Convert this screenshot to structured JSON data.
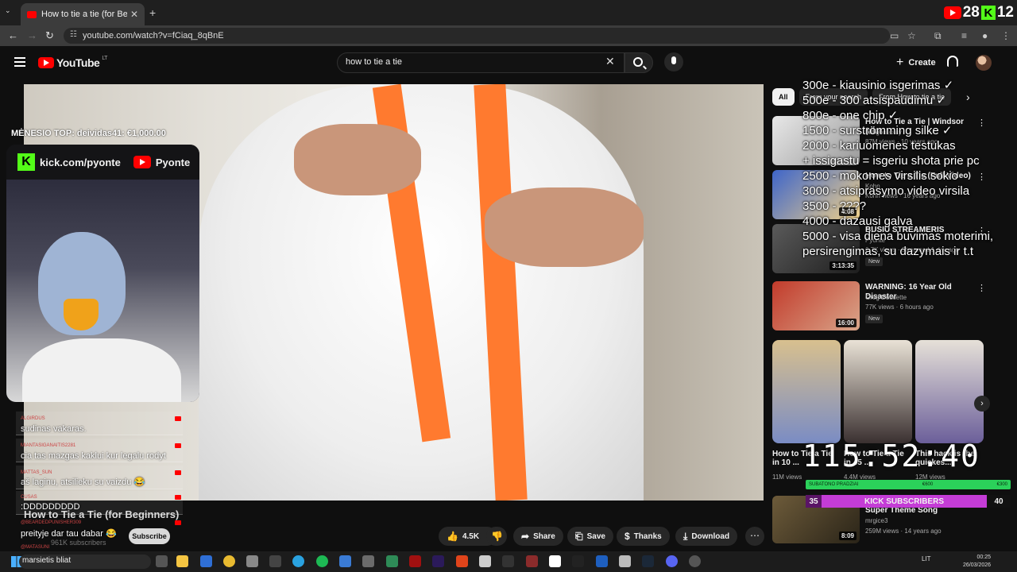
{
  "browser": {
    "tab_title": "How to tie a tie (for Beginners)",
    "url": "youtube.com/watch?v=fCiaq_8qBnE"
  },
  "overlay_top": {
    "yt_count": "28",
    "kick_count": "12"
  },
  "youtube": {
    "logo_text": "YouTube",
    "logo_region": "LT",
    "search_value": "how to tie a tie",
    "create_label": "Create"
  },
  "stream": {
    "top_donor": "MĖNESIO TOP: deividas41: €1,000.00",
    "kick_handle": "kick.com/pyonte",
    "yt_handle": "Pyonte"
  },
  "chat": [
    {
      "name": "ALGIRDUS",
      "text": "sudinas vakaras."
    },
    {
      "name": "MIANTASIGANAITIS2281",
      "text": "cia tas mazgas kaklui kur legalu rodyt"
    },
    {
      "name": "MATTAS_SUN",
      "text": "aš laginu, atsilieku su vaizdu 😂"
    },
    {
      "name": "CUSAS",
      "text": ":DDDDDDDDD"
    },
    {
      "name": "@BEARDEDPUNISHER309",
      "text": "preityje dar tau dabar 😂"
    },
    {
      "name": "@MATASUNI",
      "text": "marsietis bliat"
    }
  ],
  "video": {
    "title": "How to Tie a Tie (for Beginners)",
    "subscribers": "961K subscribers",
    "subscribe_label": "Subscribe"
  },
  "actions": {
    "likes": "4.5K",
    "share": "Share",
    "save": "Save",
    "thanks": "Thanks",
    "download": "Download"
  },
  "chips": [
    "All",
    "From your search",
    "From How to tie a tie"
  ],
  "recommendations": [
    {
      "title": "How to Tie a Tie | Windsor (aka",
      "channel": "dangonebiay",
      "meta": "87M views · 10 years ago",
      "duration": "",
      "new": ""
    },
    {
      "title": "How to Tie a Tie (Full Video)",
      "channel": "Kohn",
      "meta": "Kohn views · 16 years ago",
      "duration": "4:08",
      "new": ""
    },
    {
      "title": "BUSIU STREAMERIS",
      "channel": "Pyonte",
      "meta": "6.7K views · Streamed 1 day ago",
      "duration": "3:13:35",
      "new": "New"
    },
    {
      "title": "WARNING: 16 Year Old Disaster",
      "channel": "Greg Doucette",
      "meta": "77K views · 6 hours ago",
      "duration": "16:00",
      "new": "New"
    }
  ],
  "shorts": [
    {
      "title": "How to Tie a Tie in 10 ...",
      "views": "11M views"
    },
    {
      "title": "How to Tie a Tie in 45 ...",
      "views": "4.4M views"
    },
    {
      "title": "This hack is the quickes...",
      "views": "12M views"
    }
  ],
  "last_rec": {
    "title": "Super Theme Song",
    "channel": "mrgice3",
    "meta": "259M views · 14 years ago",
    "duration": "8:09"
  },
  "goals": [
    "300e - kiausinio isgerimas ✓",
    "500e - 300 atsispaudimu ✓",
    "800e - one chip ✓",
    "1500 - surströmming silke ✓",
    "2000 - kariuomenes testukas",
    "+ issigastu = isgeriu shota prie pc",
    "2500 - mokomes virsilis sokio",
    "3000 - atsiprasymo video virsila",
    "3500 - ????",
    "4000 - dazausi galva",
    "5000 - visa diena buvimas moterimi, persirengimas, su dazymais ir t.t"
  ],
  "clock": "115:52:40",
  "sub_bar": {
    "left": "SUBATONO PRADZIAI",
    "mid": "€600",
    "right": "€300"
  },
  "kick_bar": {
    "left": "35",
    "label": "KICK SUBSCRIBERS",
    "right": "40"
  },
  "taskbar": {
    "search_text": "marsietis bliat",
    "lang": "LIT",
    "time": "00:25",
    "date": "26/03/2026"
  },
  "colors": {
    "yt_red": "#ff0000",
    "kick_green": "#53fc18",
    "tie_orange": "#ff7a2f"
  }
}
